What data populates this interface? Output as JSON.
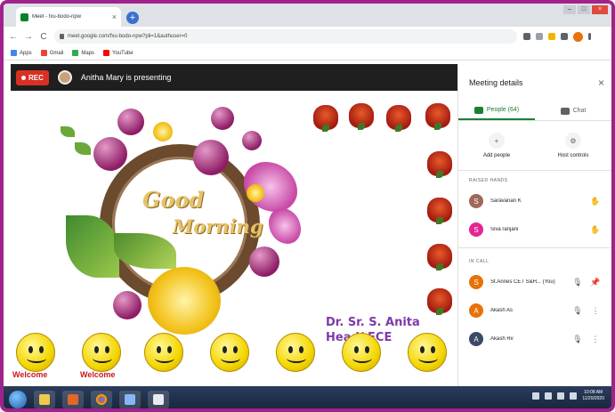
{
  "browser": {
    "tab_title": "Meet - fxu-bodo-npw",
    "tab_close": "×",
    "new_tab": "+",
    "url": "meet.google.com/fxu-bodo-npw?pli=1&authuser=0",
    "back": "←",
    "forward": "→",
    "reload": "C",
    "bookmarks": [
      {
        "label": "Apps",
        "color": "#4285f4"
      },
      {
        "label": "Gmail",
        "color": "#ea4335"
      },
      {
        "label": "Maps",
        "color": "#34a853"
      },
      {
        "label": "YouTube",
        "color": "#ff0000"
      }
    ]
  },
  "meet": {
    "rec_label": "REC",
    "presenting_text": "Anitha Mary is presenting"
  },
  "slide": {
    "greeting_line1": "Good",
    "greeting_line2": "Morning",
    "signature_line1": "Dr. Sr. S. Anita",
    "signature_line2": "Head/ ECE",
    "red_caption": "Welcome"
  },
  "panel": {
    "title": "Meeting details",
    "close": "×",
    "tabs": [
      {
        "label": "People (64)",
        "icon": "people-icon",
        "active": true
      },
      {
        "label": "Chat",
        "icon": "chat-icon",
        "active": false
      }
    ],
    "actions": [
      {
        "label": "Add people",
        "icon": "add-person-icon",
        "glyph": "+"
      },
      {
        "label": "Host controls",
        "icon": "host-controls-icon",
        "glyph": "⚙"
      }
    ],
    "raised_hands_header": "RAISED HANDS",
    "raised_hands": [
      {
        "initial": "S",
        "name": "Saravanan K",
        "color": "#a0685a",
        "icon": "✋"
      },
      {
        "initial": "S",
        "name": "Siva ranjani",
        "color": "#e52592",
        "icon": "✋"
      }
    ],
    "in_call_header": "IN CALL",
    "in_call": [
      {
        "initial": "S",
        "name": "St.Annes CET S&H... (You)",
        "color": "#e8710a",
        "icon1": "🎙",
        "icon2": "📌"
      },
      {
        "initial": "A",
        "name": "Akash As",
        "color": "#e8710a",
        "icon1": "🎙",
        "icon2": "⋮"
      },
      {
        "initial": "A",
        "name": "Akash Rv",
        "color": "#3c4a66",
        "icon1": "🎙",
        "icon2": "⋮"
      }
    ]
  },
  "taskbar": {
    "time": "10:08 AM",
    "date": "11/20/2020"
  },
  "colors": {
    "frame": "#a0238d",
    "rec": "#d93025",
    "accent": "#188038"
  }
}
